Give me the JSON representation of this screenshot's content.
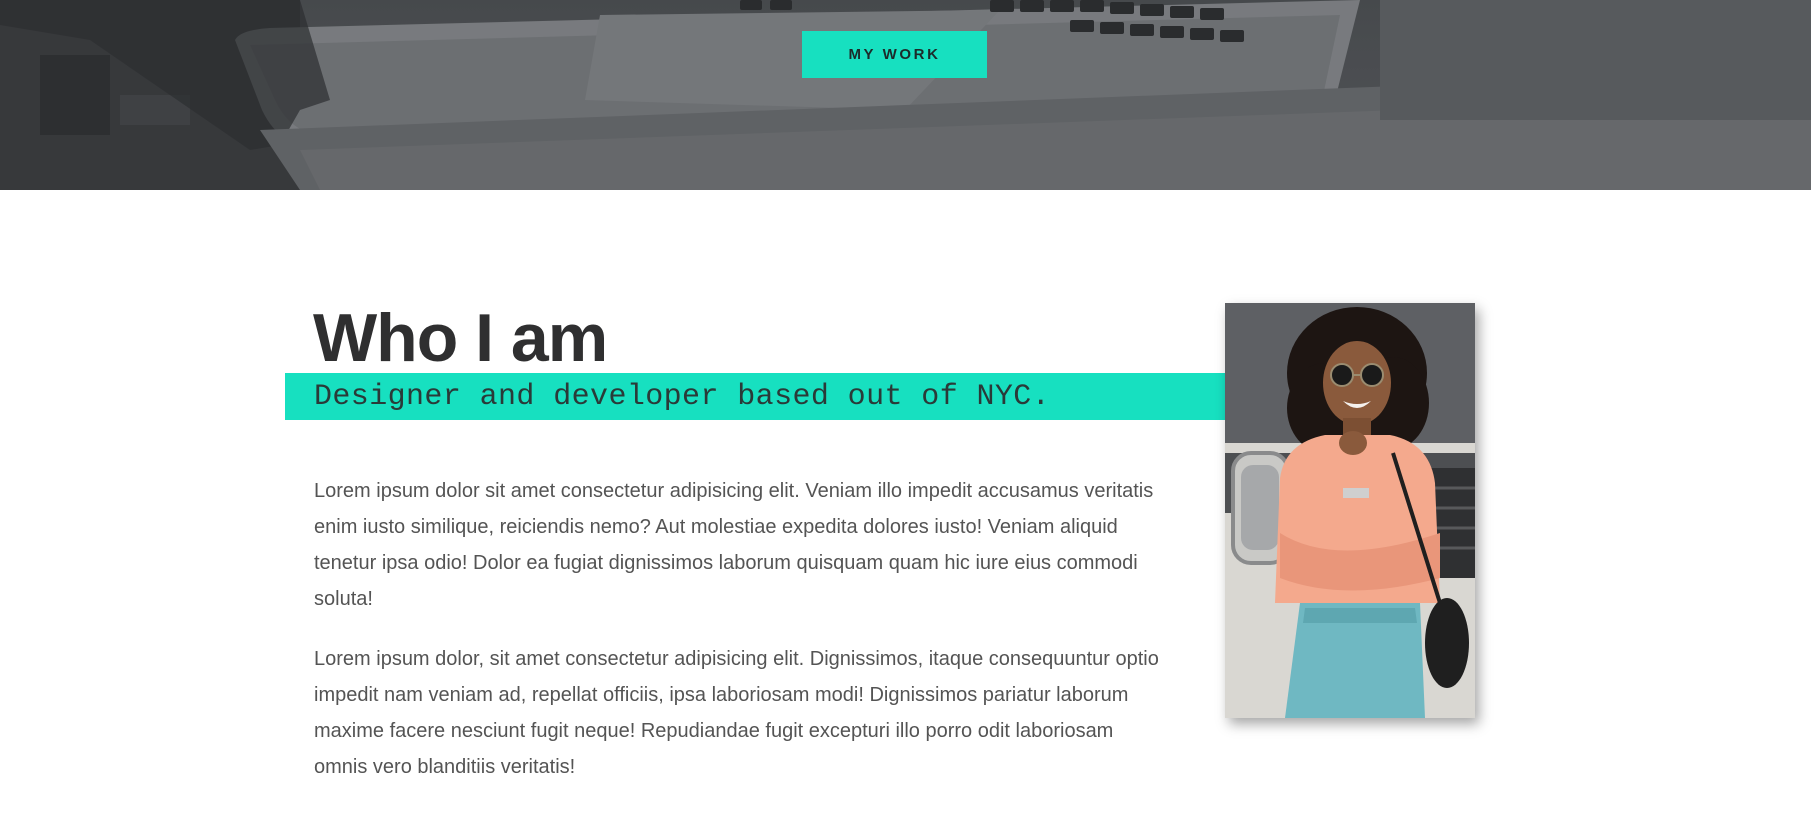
{
  "hero": {
    "cta_label": "MY WORK",
    "image_icon": "laptop-photo"
  },
  "about": {
    "title": "Who I am",
    "subtitle": "Designer and developer based out of NYC.",
    "paragraphs": [
      "Lorem ipsum dolor sit amet consectetur adipisicing elit. Veniam illo impedit accusamus veritatis enim iusto similique, reiciendis nemo? Aut molestiae expedita dolores iusto! Veniam aliquid tenetur ipsa odio! Dolor ea fugiat dignissimos laborum quisquam quam hic iure eius commodi soluta!",
      "Lorem ipsum dolor, sit amet consectetur adipisicing elit. Dignissimos, itaque consequuntur optio impedit nam veniam ad, repellat officiis, ipsa laboriosam modi! Dignissimos pariatur laborum maxime facere nesciunt fugit neque! Repudiandae fugit excepturi illo porro odit laboriosam omnis vero blanditiis veritatis!"
    ],
    "portrait_icon": "person-photo"
  },
  "colors": {
    "accent": "#17e0c0",
    "heading": "#2f2f30",
    "body_text": "#545454",
    "hero_bg": "#55575b"
  }
}
